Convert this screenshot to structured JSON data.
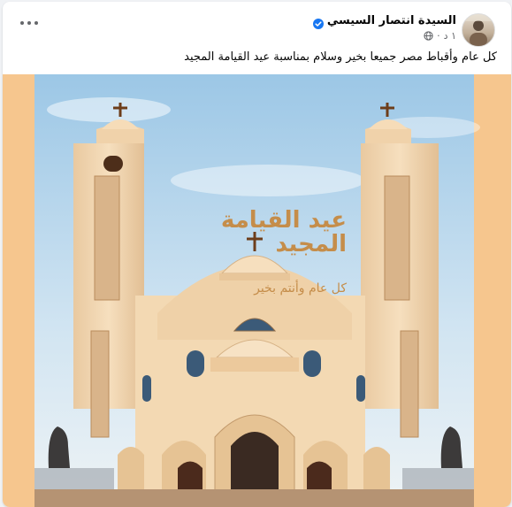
{
  "post": {
    "author_name": "السيدة انتصار السيسي",
    "timestamp": "١ د",
    "caption": "كل عام وأقباط مصر جميعا بخير وسلام بمناسبة عيد القيامة المجيد",
    "verified": true
  },
  "image": {
    "title_line1": "عيد القيامة",
    "title_line2": "المجيد",
    "subtitle": "كل عام وأنتم بخير"
  },
  "colors": {
    "accent_verified": "#1877f2",
    "image_border": "#f6c68e",
    "title_gold": "#c58d4a",
    "sky": "#bcd9ef",
    "church": "#f0d5b0"
  },
  "icons": {
    "more": "more-options-icon",
    "verified": "verified-badge-icon",
    "audience": "globe-icon"
  }
}
